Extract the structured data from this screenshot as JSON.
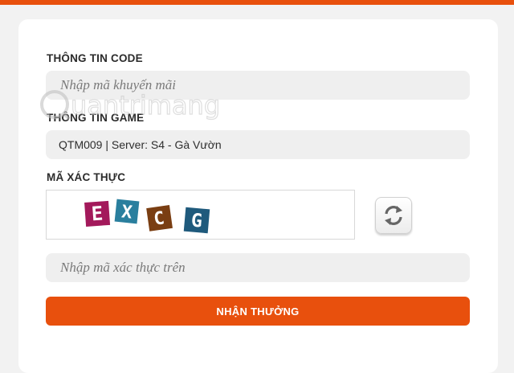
{
  "colors": {
    "accent": "#e8500d",
    "field_bg": "#efefef",
    "captcha_purple": "#a3195b",
    "captcha_teal": "#2a7f9e",
    "captcha_brown": "#7a3e12",
    "captcha_navy": "#1f5a7c"
  },
  "code_section": {
    "label": "THÔNG TIN CODE",
    "placeholder": "Nhập mã khuyến mãi"
  },
  "game_section": {
    "label": "THÔNG TIN GAME",
    "value": "QTM009 | Server: S4 - Gà Vườn"
  },
  "captcha_section": {
    "label": "MÃ XÁC THỰC",
    "captcha_letters": [
      "E",
      "X",
      "C",
      "G"
    ],
    "refresh_icon": "refresh-icon",
    "placeholder": "Nhập mã xác thực trên"
  },
  "submit": {
    "label": "NHẬN THƯỞNG"
  },
  "watermark": {
    "text": "uantrimang"
  }
}
